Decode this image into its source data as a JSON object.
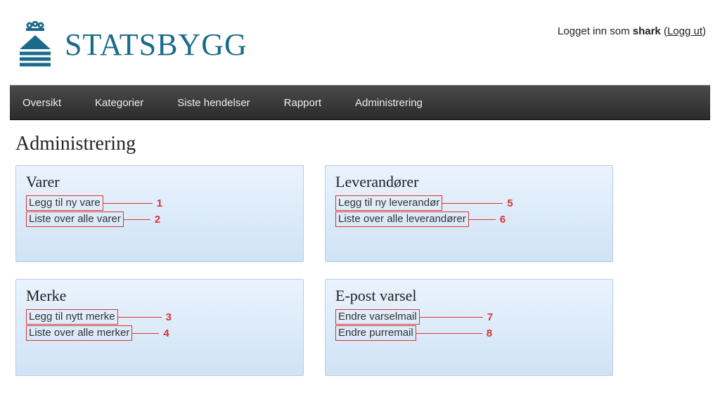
{
  "header": {
    "brand": "STATSBYGG",
    "login_prefix": "Logget inn som ",
    "username": "shark",
    "logout_label": "Logg ut"
  },
  "nav": {
    "items": [
      "Oversikt",
      "Kategorier",
      "Siste hendelser",
      "Rapport",
      "Administrering"
    ]
  },
  "page_title": "Administrering",
  "panels": [
    {
      "title": "Varer",
      "links": [
        {
          "label": "Legg til ny vare",
          "num": "1",
          "line_w": 70
        },
        {
          "label": "Liste over alle varer",
          "num": "2",
          "line_w": 38
        }
      ]
    },
    {
      "title": "Leverandører",
      "links": [
        {
          "label": "Legg til ny leverandør",
          "num": "5",
          "line_w": 86
        },
        {
          "label": "Liste over alle leverandører",
          "num": "6",
          "line_w": 38
        }
      ]
    },
    {
      "title": "Merke",
      "links": [
        {
          "label": "Legg til nytt merke",
          "num": "3",
          "line_w": 62
        },
        {
          "label": "Liste over alle merker",
          "num": "4",
          "line_w": 38
        }
      ]
    },
    {
      "title": "E-post varsel",
      "links": [
        {
          "label": "Endre varselmail",
          "num": "7",
          "line_w": 90
        },
        {
          "label": "Endre purremail",
          "num": "8",
          "line_w": 94
        }
      ]
    }
  ],
  "colors": {
    "brand": "#1a6b8a",
    "annotation": "#d33"
  }
}
